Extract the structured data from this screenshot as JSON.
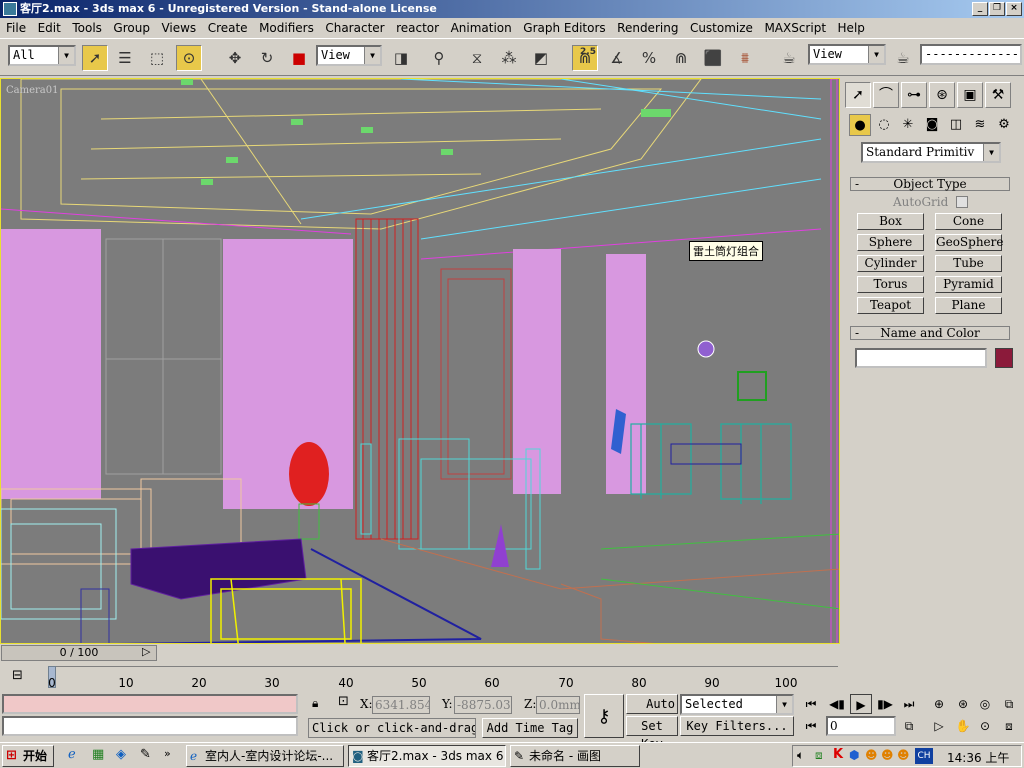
{
  "window": {
    "title": "客厅2.max - 3ds max 6 - Unregistered Version - Stand-alone License"
  },
  "menu": [
    "File",
    "Edit",
    "Tools",
    "Group",
    "Views",
    "Create",
    "Modifiers",
    "Character",
    "reactor",
    "Animation",
    "Graph Editors",
    "Rendering",
    "Customize",
    "MAXScript",
    "Help"
  ],
  "toolbar": {
    "selection_filter": "All",
    "ref_coord": "View",
    "snaps_value": "2.5",
    "render_view": "View",
    "named_sel": "-------------"
  },
  "viewport": {
    "label": "Camera01",
    "tooltip": "雷土筒灯组合"
  },
  "command_panel": {
    "category": "Standard Primitiv",
    "object_type_title": "Object Type",
    "autogrid": "AutoGrid",
    "buttons": [
      "Box",
      "Cone",
      "Sphere",
      "GeoSphere",
      "Cylinder",
      "Tube",
      "Torus",
      "Pyramid",
      "Teapot",
      "Plane"
    ],
    "name_color_title": "Name and Color",
    "object_color": "#8b1a3a",
    "collapse": "-"
  },
  "time_slider": {
    "label": "0 / 100",
    "position": 0,
    "total": 100
  },
  "trackbar": {
    "ticks": [
      "0",
      "10",
      "20",
      "30",
      "40",
      "50",
      "60",
      "70",
      "80",
      "90",
      "100"
    ]
  },
  "status": {
    "x_label": "X:",
    "x_value": "6341.854",
    "y_label": "Y:",
    "y_value": "-8875.03",
    "z_label": "Z:",
    "z_value": "0.0mm",
    "prompt": "Click or click-and-drag",
    "add_time_tag": "Add Time Tag",
    "auto_key": "Auto Key",
    "set_key": "Set Key",
    "key_mode": "Selected",
    "key_filters": "Key Filters...",
    "frame": "0"
  },
  "taskbar": {
    "start": "开始",
    "tasks": [
      "室内人-室内设计论坛-...",
      "客厅2.max - 3ds max 6 - ...",
      "未命名 - 画图"
    ],
    "ime": "CH",
    "clock": "14:36 上午"
  }
}
